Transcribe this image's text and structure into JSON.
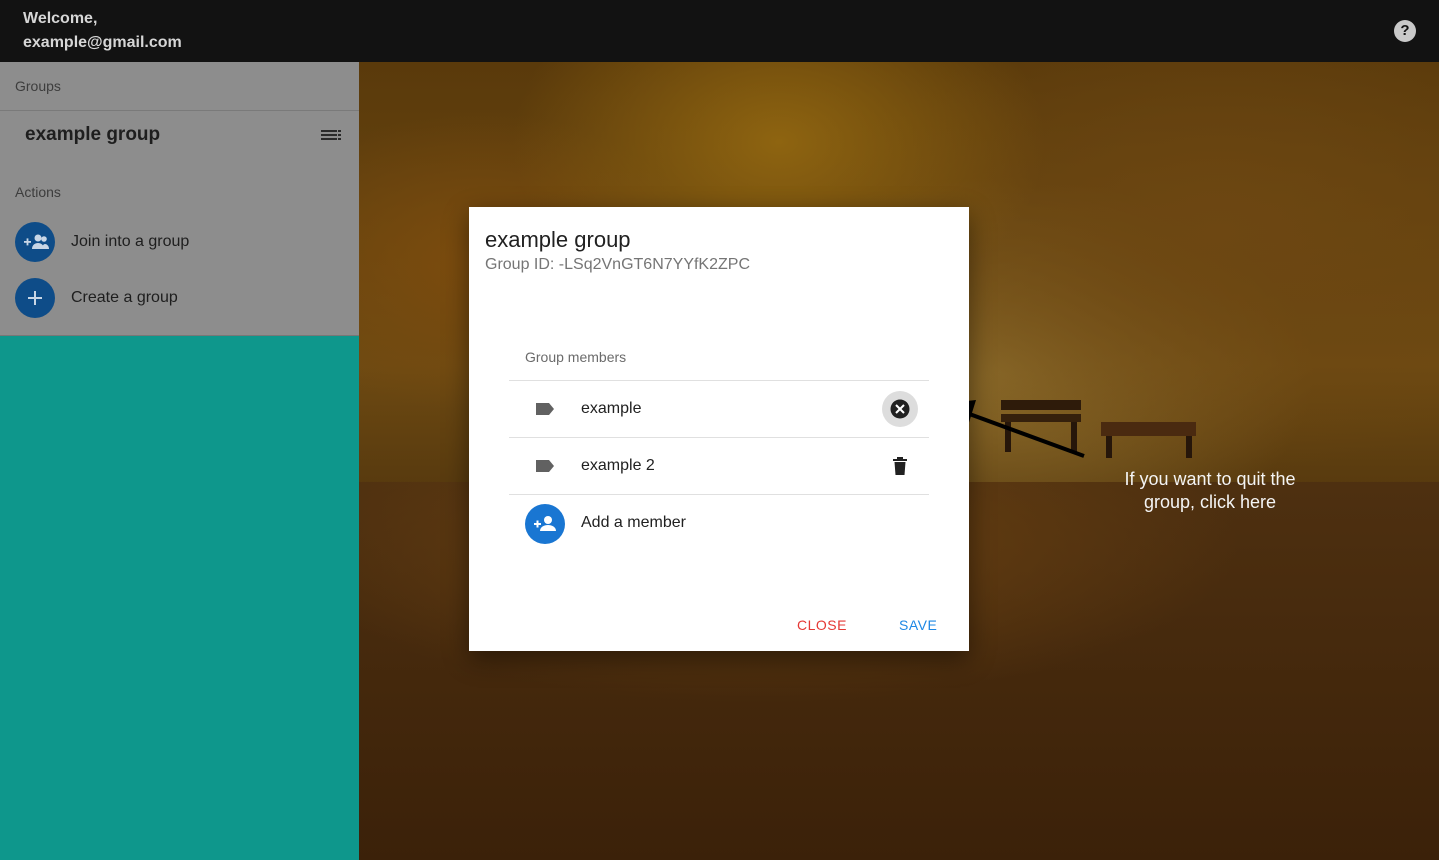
{
  "header": {
    "welcome_line1": "Welcome,",
    "welcome_line2": "example@gmail.com",
    "help_icon": "?"
  },
  "sidebar": {
    "groups_label": "Groups",
    "group_name": "example group",
    "actions_label": "Actions",
    "actions": [
      {
        "label": "Join into a group",
        "icon": "group-add-icon"
      },
      {
        "label": "Create a group",
        "icon": "plus-icon"
      }
    ]
  },
  "dialog": {
    "title": "example group",
    "group_id": "Group ID: -LSq2VnGT6N7YYfK2ZPC",
    "members_label": "Group members",
    "members": [
      {
        "name": "example",
        "action_icon": "cancel-circle-icon"
      },
      {
        "name": "example 2",
        "action_icon": "trash-icon"
      }
    ],
    "add_member_label": "Add a member",
    "close_label": "CLOSE",
    "save_label": "SAVE"
  },
  "hint": {
    "text_line1": "If you want to quit the",
    "text_line2": "group, click here"
  },
  "colors": {
    "primary_blue": "#1976d2",
    "close_red": "#e53935",
    "sidebar_teal": "#0e978c"
  }
}
